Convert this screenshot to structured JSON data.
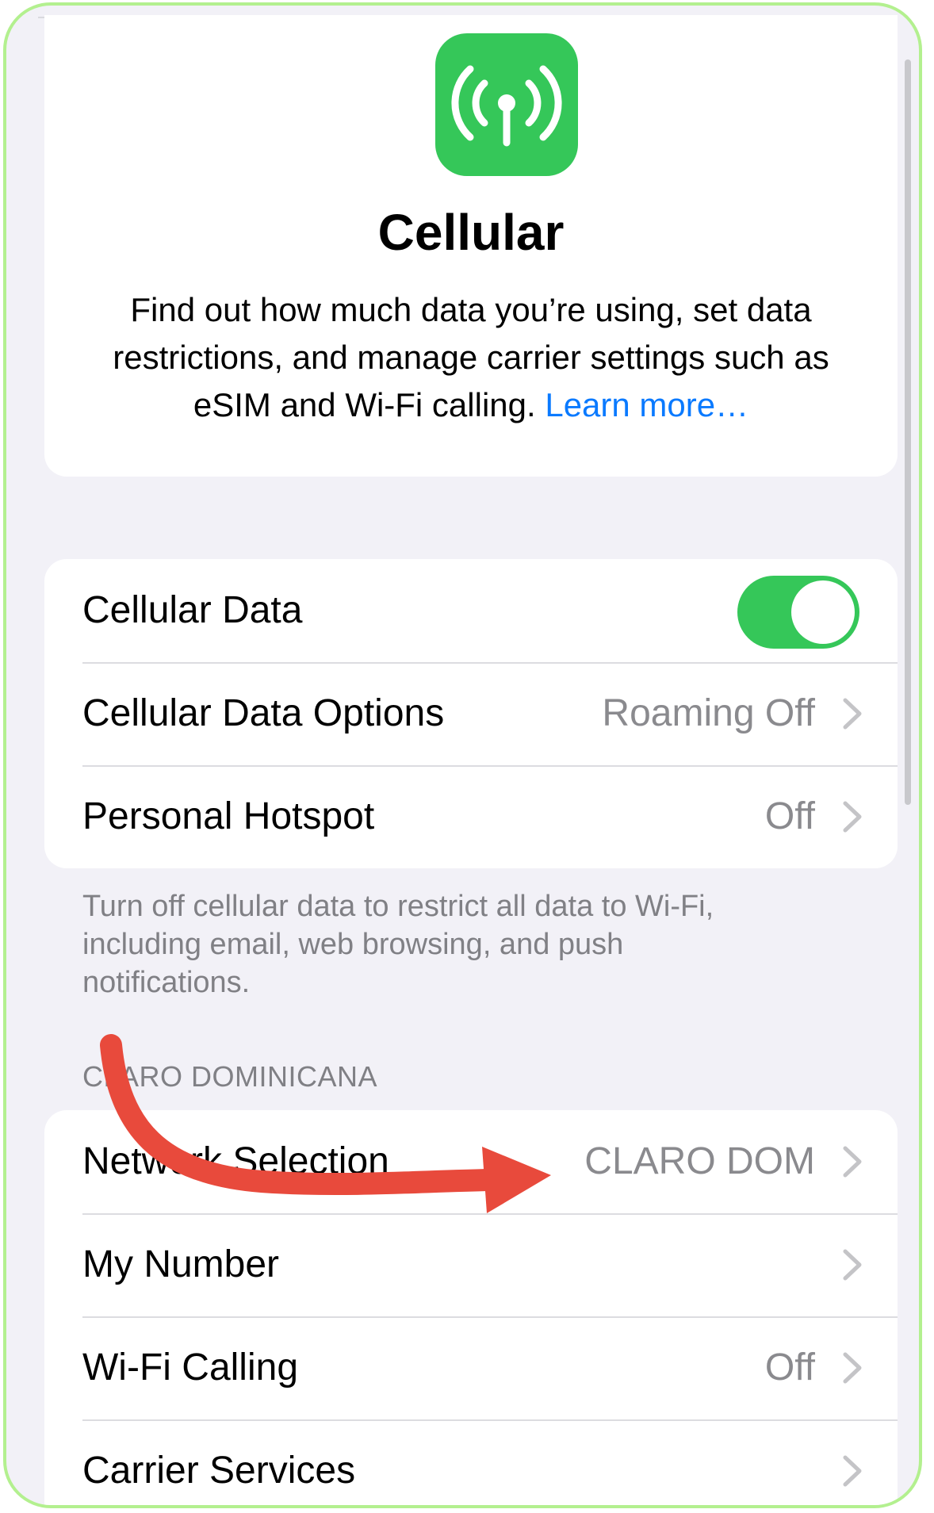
{
  "header": {
    "title": "Cellular",
    "description_text": "Find out how much data you’re using, set data restrictions, and manage carrier settings such as eSIM and Wi-Fi calling.",
    "learn_more": "Learn more…",
    "icon": "antenna-icon"
  },
  "data_section": {
    "rows": [
      {
        "label": "Cellular Data",
        "toggle_on": true
      },
      {
        "label": "Cellular Data Options",
        "value": "Roaming Off"
      },
      {
        "label": "Personal Hotspot",
        "value": "Off"
      }
    ],
    "footnote": "Turn off cellular data to restrict all data to Wi-Fi, including email, web browsing, and push notifications."
  },
  "carrier_section": {
    "header": "CLARO DOMINICANA",
    "rows": [
      {
        "label": "Network Selection",
        "value": "CLARO DOM"
      },
      {
        "label": "My Number",
        "value": ""
      },
      {
        "label": "Wi-Fi Calling",
        "value": "Off"
      },
      {
        "label": "Carrier Services",
        "value": ""
      }
    ]
  },
  "colors": {
    "accent_green": "#35c759",
    "link_blue": "#0a7aff",
    "annotation_arrow": "#e84a3c",
    "frame_border": "#b3f08f"
  }
}
